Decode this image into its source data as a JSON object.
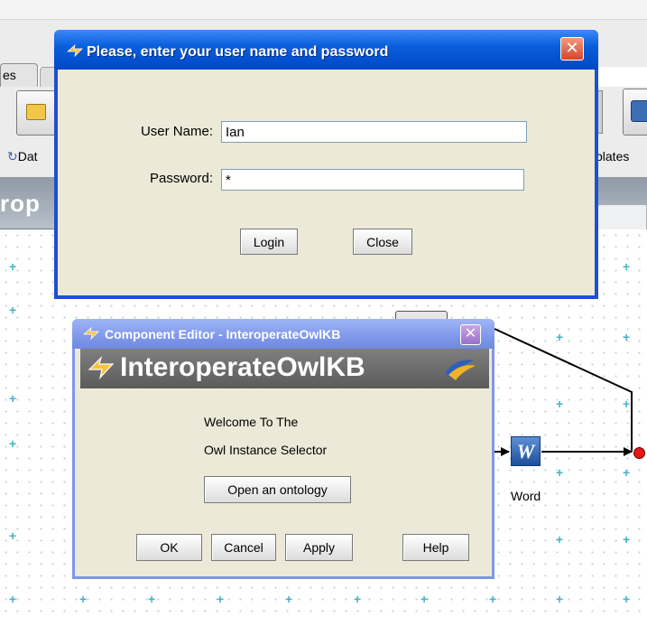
{
  "background": {
    "tab_label": "es",
    "toolbar_left_label": "Dat",
    "toolbar_right_label": "plates",
    "heading_text": "rop",
    "word_label": "Word"
  },
  "login": {
    "title": "Please, enter your user name and password",
    "username_label": "User Name:",
    "username_value": "Ian",
    "password_label": "Password:",
    "password_value": "*",
    "login_button": "Login",
    "close_button": "Close",
    "close_glyph": "✕"
  },
  "component_editor": {
    "title": "Component Editor - InteroperateOwlKB",
    "close_glyph": "✕",
    "header_text": "InteroperateOwlKB",
    "welcome_line1": "Welcome To The",
    "welcome_line2": "Owl Instance Selector",
    "open_button": "Open an ontology",
    "ok_button": "OK",
    "cancel_button": "Cancel",
    "apply_button": "Apply",
    "help_button": "Help"
  },
  "icons": {
    "word_icon": "W",
    "app_logo": "logo-icon"
  },
  "colors": {
    "login_title_bar": "#0a5fdc",
    "component_title_bar": "#7f98ea",
    "close_button_red": "#d6452a",
    "endpoint_red": "#e01818",
    "grid_plus": "#46b3c7"
  }
}
